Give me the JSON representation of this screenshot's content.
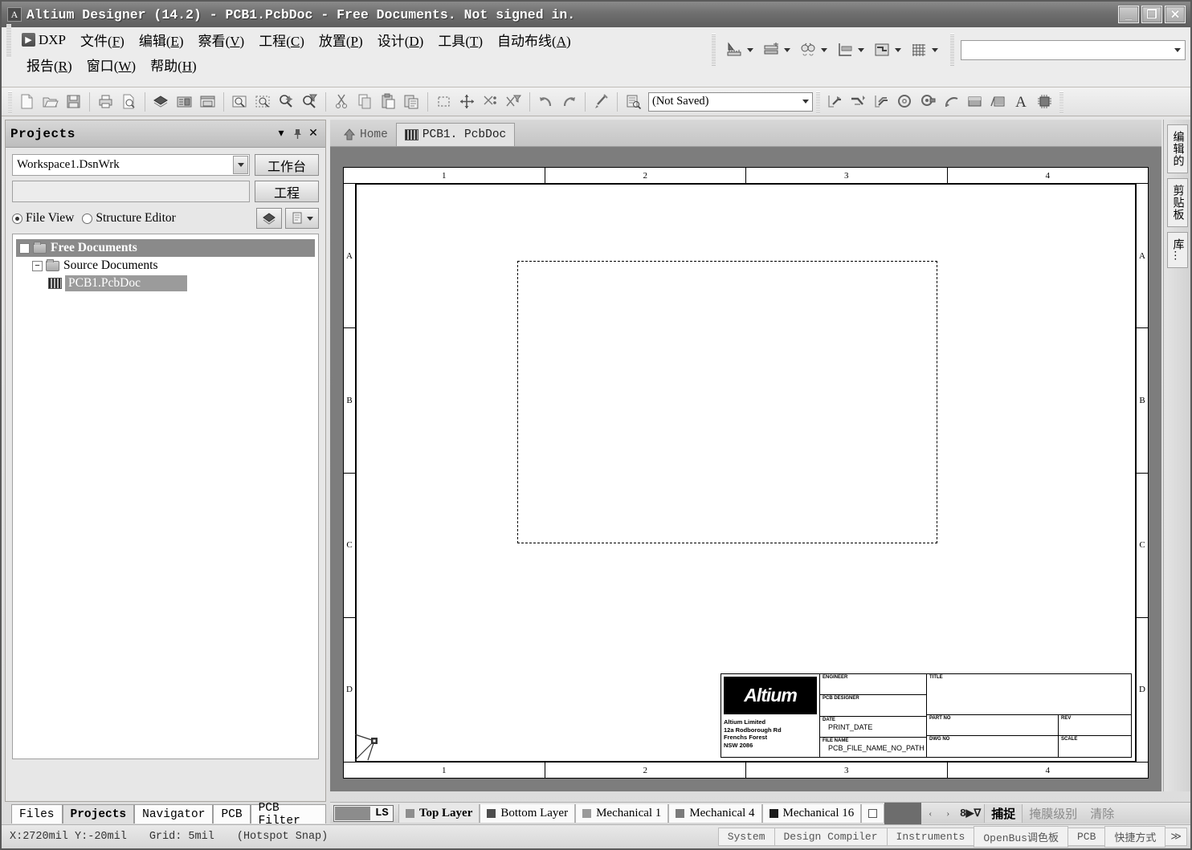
{
  "window": {
    "title": "Altium Designer (14.2) - PCB1.PcbDoc - Free Documents. Not signed in.",
    "app_icon": "A",
    "minimize": "_",
    "maximize": "❐",
    "close": "✕"
  },
  "menu": {
    "dxp": "DXP",
    "row1": [
      {
        "label": "文件",
        "key": "F"
      },
      {
        "label": "编辑",
        "key": "E"
      },
      {
        "label": "察看",
        "key": "V"
      },
      {
        "label": "工程",
        "key": "C"
      },
      {
        "label": "放置",
        "key": "P"
      },
      {
        "label": "设计",
        "key": "D"
      },
      {
        "label": "工具",
        "key": "T"
      },
      {
        "label": "自动布线",
        "key": "A"
      }
    ],
    "row2": [
      {
        "label": "报告",
        "key": "R"
      },
      {
        "label": "窗口",
        "key": "W"
      },
      {
        "label": "帮助",
        "key": "H"
      }
    ],
    "right_tools": [
      "measure-icon",
      "layer-stack-icon",
      "find-icon",
      "dimension-icon",
      "route-setup-icon",
      "grid-icon"
    ],
    "combo_value": ""
  },
  "toolbar": {
    "group1": [
      "new-document-icon",
      "open-document-icon",
      "save-document-icon"
    ],
    "group2": [
      "print-icon",
      "print-preview-icon"
    ],
    "group3": [
      "board-layers-icon",
      "pcb-board-icon",
      "split-window-icon"
    ],
    "group4": [
      "zoom-fit-icon",
      "zoom-area-icon",
      "zoom-selected-icon",
      "zoom-filtered-icon"
    ],
    "group5": [
      "cut-icon",
      "copy-icon",
      "paste-icon",
      "paste-special-icon"
    ],
    "group6": [
      "select-area-icon",
      "move-selection-icon",
      "clear-selection-icon",
      "deselect-filter-icon"
    ],
    "group7": [
      "undo-icon",
      "redo-icon"
    ],
    "group8": [
      "crosshair-pick-icon"
    ],
    "group9": [
      "inspect-icon"
    ],
    "saved_combo": "(Not Saved)",
    "group10": [
      "place-line-icon",
      "interactive-route-icon",
      "route-diff-pair-icon",
      "place-via-icon",
      "place-pad-icon",
      "place-arc-icon",
      "place-fill-icon",
      "polygon-pour-icon",
      "place-string-icon",
      "place-component-icon"
    ]
  },
  "projects_panel": {
    "title": "Projects",
    "header_buttons": [
      "chevron-down-icon",
      "pin-icon",
      "close-icon"
    ],
    "workspace_combo": "Workspace1.DsnWrk",
    "workspace_button": "工作台",
    "project_button": "工程",
    "search_field": "",
    "view_modes": [
      {
        "label": "File View",
        "selected": true
      },
      {
        "label": "Structure Editor",
        "selected": false
      }
    ],
    "tree": [
      {
        "label": "Free Documents",
        "icon": "folder-icon",
        "level": 0,
        "selected": true,
        "expanded": true,
        "bold": true
      },
      {
        "label": "Source Documents",
        "icon": "folder-icon",
        "level": 1,
        "selected": false,
        "expanded": true,
        "bold": false
      },
      {
        "label": "PCB1.PcbDoc",
        "icon": "pcb-document-icon",
        "level": 2,
        "selected": true,
        "expanded": null,
        "bold": false
      }
    ],
    "tabs": [
      {
        "label": "Files",
        "active": false
      },
      {
        "label": "Projects",
        "active": true
      },
      {
        "label": "Navigator",
        "active": false
      },
      {
        "label": "PCB",
        "active": false
      },
      {
        "label": "PCB Filter",
        "active": false
      }
    ]
  },
  "document_tabs": [
    {
      "label": "Home",
      "icon": "home-icon",
      "active": false
    },
    {
      "label": "PCB1. PcbDoc",
      "icon": "pcb-document-icon",
      "active": true
    }
  ],
  "sheet": {
    "zones_horizontal": [
      "1",
      "2",
      "3",
      "4"
    ],
    "zones_vertical": [
      "A",
      "B",
      "C",
      "D"
    ],
    "title_block": {
      "logo": "Altium",
      "address": [
        "Altium Limited",
        "12a Rodborough Rd",
        "Frenchs Forest",
        "NSW 2086"
      ],
      "engineer_caption": "ENGINEER",
      "engineer_value": "",
      "pcb_designer_caption": "PCB DESIGNER",
      "pcb_designer_value": "",
      "title_caption": "TITLE",
      "title_value": "",
      "date_caption": "DATE",
      "date_value": "PRINT_DATE",
      "file_name_caption": "FILE NAME",
      "file_name_value": "PCB_FILE_NAME_NO_PATH",
      "part_no_caption": "PART NO",
      "part_no_value": "",
      "rev_caption": "REV",
      "rev_value": "",
      "dwg_no_caption": "DWG NO",
      "dwg_no_value": "",
      "scale_caption": "SCALE",
      "scale_value": ""
    }
  },
  "right_tabs": [
    {
      "label": "编辑的"
    },
    {
      "label": "剪贴板"
    },
    {
      "label": "库..."
    }
  ],
  "layer_bar": {
    "ls_label": "LS",
    "layers": [
      {
        "label": "Top Layer",
        "color": "#8e8e8e",
        "active": true
      },
      {
        "label": "Bottom Layer",
        "color": "#4d4d4d",
        "active": false
      },
      {
        "label": "Mechanical 1",
        "color": "#9a9a9a",
        "active": false
      },
      {
        "label": "Mechanical 4",
        "color": "#7b7b7b",
        "active": false
      },
      {
        "label": "Mechanical 16",
        "color": "#1c1c1c",
        "active": false
      }
    ],
    "empty_swatch": "□",
    "prev_arrow": "‹",
    "next_arrow": "›",
    "mask_icon": "8▶∇",
    "buttons": [
      {
        "label": "捕捉",
        "active": true
      },
      {
        "label": "掩膜级别",
        "active": false
      },
      {
        "label": "清除",
        "active": false
      }
    ]
  },
  "status_bar": {
    "coordinates": "X:2720mil Y:-20mil",
    "grid": "Grid: 5mil",
    "snap_mode": "(Hotspot Snap)",
    "panels": [
      "System",
      "Design Compiler",
      "Instruments",
      "OpenBus调色板",
      "PCB",
      "快捷方式"
    ],
    "expand": "≫"
  }
}
